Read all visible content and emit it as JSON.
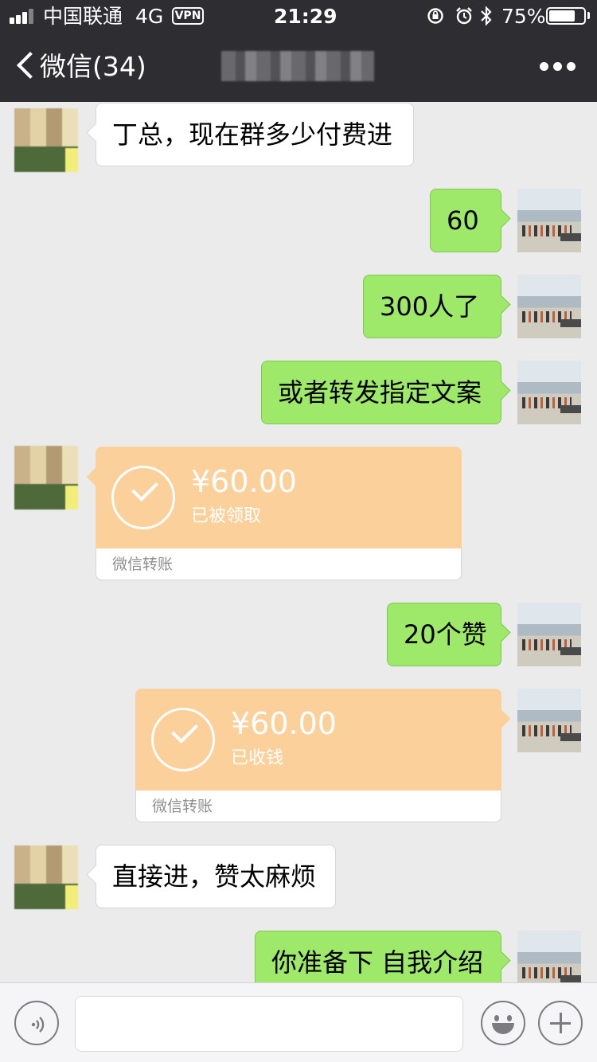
{
  "status_bar": {
    "carrier": "中国联通",
    "network": "4G",
    "vpn": "VPN",
    "time": "21:29",
    "battery_percent": "75%",
    "battery_level": 0.75
  },
  "nav": {
    "back_label": "微信(34)"
  },
  "messages": [
    {
      "side": "in",
      "text": "丁总，现在群多少付费进"
    },
    {
      "side": "out",
      "text": "60"
    },
    {
      "side": "out",
      "text": "300人了"
    },
    {
      "side": "out",
      "text": "或者转发指定文案"
    },
    {
      "side": "in",
      "type": "transfer",
      "amount": "¥60.00",
      "status": "已被领取",
      "label": "微信转账"
    },
    {
      "side": "out",
      "text": "20个赞"
    },
    {
      "side": "out",
      "type": "transfer",
      "amount": "¥60.00",
      "status": "已收钱",
      "label": "微信转账"
    },
    {
      "side": "in",
      "text": "直接进，赞太麻烦"
    },
    {
      "side": "out",
      "text": "你准备下 自我介绍"
    }
  ],
  "icons": {
    "status": [
      "signal-icon",
      "orientation-lock-icon",
      "alarm-icon",
      "bluetooth-icon",
      "battery-icon"
    ],
    "nav": [
      "chevron-left-icon",
      "more-icon"
    ],
    "input_bar": [
      "voice-icon",
      "emoji-icon",
      "plus-icon"
    ]
  },
  "colors": {
    "nav_background": "#2e2e32",
    "chat_background": "#ebebeb",
    "outgoing_bubble": "#9ee86a",
    "incoming_bubble": "#ffffff",
    "transfer_card": "#fcd09b"
  }
}
